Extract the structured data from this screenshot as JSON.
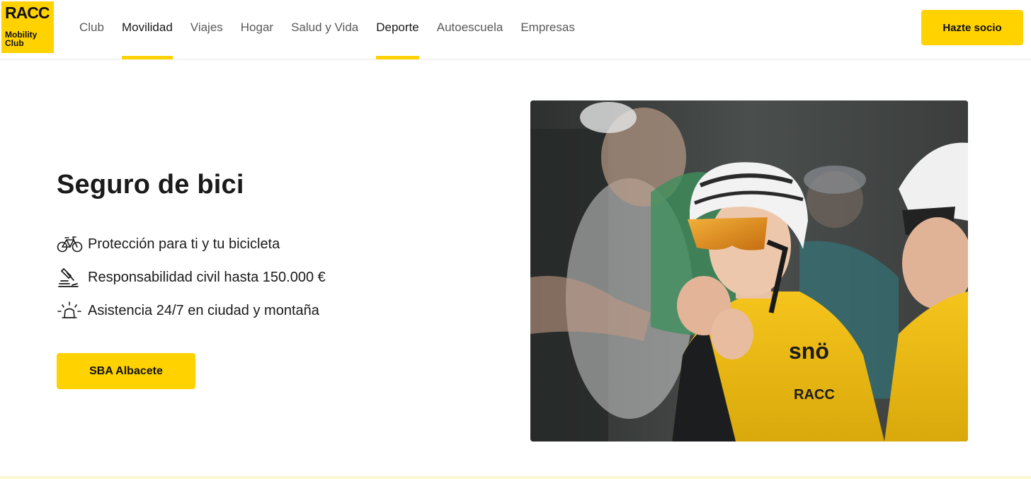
{
  "logo": {
    "brand": "RACC",
    "line1": "Mobility",
    "line2": "Club"
  },
  "nav": {
    "items": [
      {
        "label": "Club",
        "active": false
      },
      {
        "label": "Movilidad",
        "active": true
      },
      {
        "label": "Viajes",
        "active": false
      },
      {
        "label": "Hogar",
        "active": false
      },
      {
        "label": "Salud y Vida",
        "active": false
      },
      {
        "label": "Deporte",
        "active": true
      },
      {
        "label": "Autoescuela",
        "active": false
      },
      {
        "label": "Empresas",
        "active": false
      }
    ],
    "cta_label": "Hazte socio"
  },
  "hero": {
    "title": "Seguro de bici",
    "features": [
      {
        "icon": "bicycle-icon",
        "text": "Protección para ti y tu bicicleta"
      },
      {
        "icon": "gavel-icon",
        "text": "Responsabilidad civil hasta 150.000 €"
      },
      {
        "icon": "siren-icon",
        "text": "Asistencia 24/7 en ciudad y montaña"
      }
    ],
    "cta_label": "SBA Albacete",
    "image": {
      "jersey_text_1": "snö",
      "jersey_text_2": "RACC"
    }
  },
  "colors": {
    "accent": "#ffd200",
    "text": "#1a1a1a",
    "nav_text": "#5a5a5a"
  }
}
